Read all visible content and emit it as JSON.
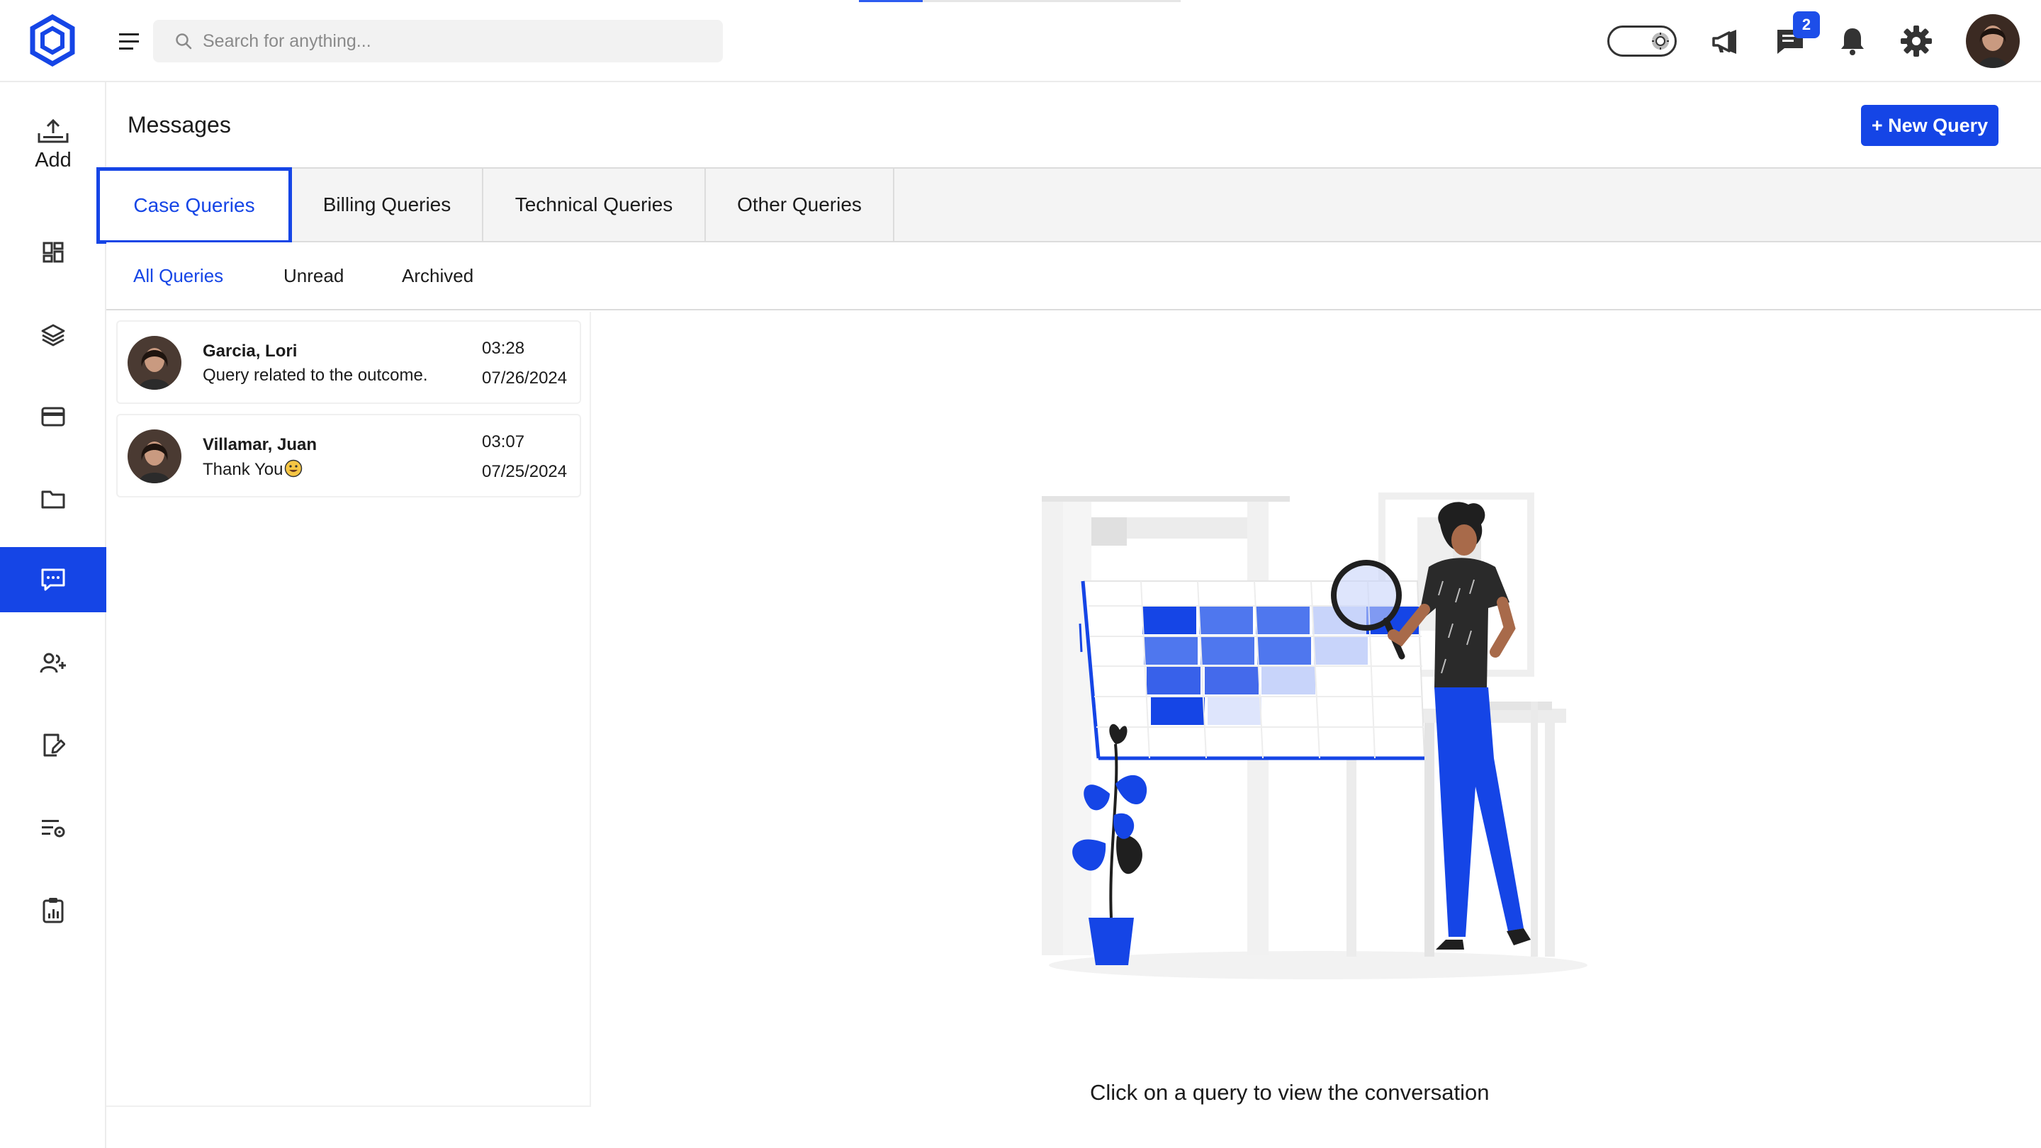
{
  "header": {
    "search_placeholder": "Search for anything...",
    "messages_badge": "2"
  },
  "sidebar": {
    "add_label": "Add",
    "items": [
      "dashboard",
      "layers",
      "billing",
      "folder",
      "messages",
      "add-user",
      "edit-document",
      "settings-list",
      "reports"
    ]
  },
  "main": {
    "title": "Messages",
    "new_query_label": "+ New Query",
    "tabs": [
      {
        "label": "Case Queries",
        "active": true
      },
      {
        "label": "Billing Queries",
        "active": false
      },
      {
        "label": "Technical Queries",
        "active": false
      },
      {
        "label": "Other Queries",
        "active": false
      }
    ],
    "subtabs": [
      {
        "label": "All Queries",
        "active": true
      },
      {
        "label": "Unread",
        "active": false
      },
      {
        "label": "Archived",
        "active": false
      }
    ],
    "queries": [
      {
        "name": "Garcia, Lori",
        "message": "Query related to the outcome.",
        "time": "03:28",
        "date": "07/26/2024"
      },
      {
        "name": "Villamar, Juan",
        "message": "Thank You",
        "time": "03:07",
        "date": "07/25/2024"
      }
    ],
    "empty_state": "Click on a query to view the conversation"
  },
  "colors": {
    "accent": "#1545e6",
    "tab_bg": "#f4f4f4",
    "border": "#dcdcdc"
  }
}
